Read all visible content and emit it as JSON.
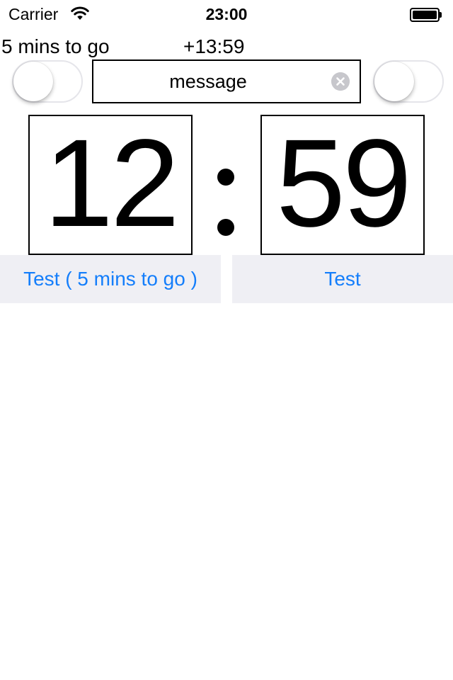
{
  "status_bar": {
    "carrier": "Carrier",
    "time": "23:00",
    "icons": [
      "wifi-icon",
      "battery-icon"
    ]
  },
  "info": {
    "countdown_label": "5 mins to go",
    "elapsed_label": "+13:59"
  },
  "controls": {
    "left_switch_on": false,
    "right_switch_on": false,
    "message_value": "message",
    "clear_icon": "clear-icon"
  },
  "timer": {
    "minutes": "12",
    "seconds": "59"
  },
  "buttons": {
    "left_label": "Test ( 5 mins to go )",
    "right_label": "Test"
  },
  "colors": {
    "accent": "#147efb",
    "button_background": "#efeff4",
    "switch_border": "#e5e5ea",
    "clear_button": "#c7c7cc"
  }
}
